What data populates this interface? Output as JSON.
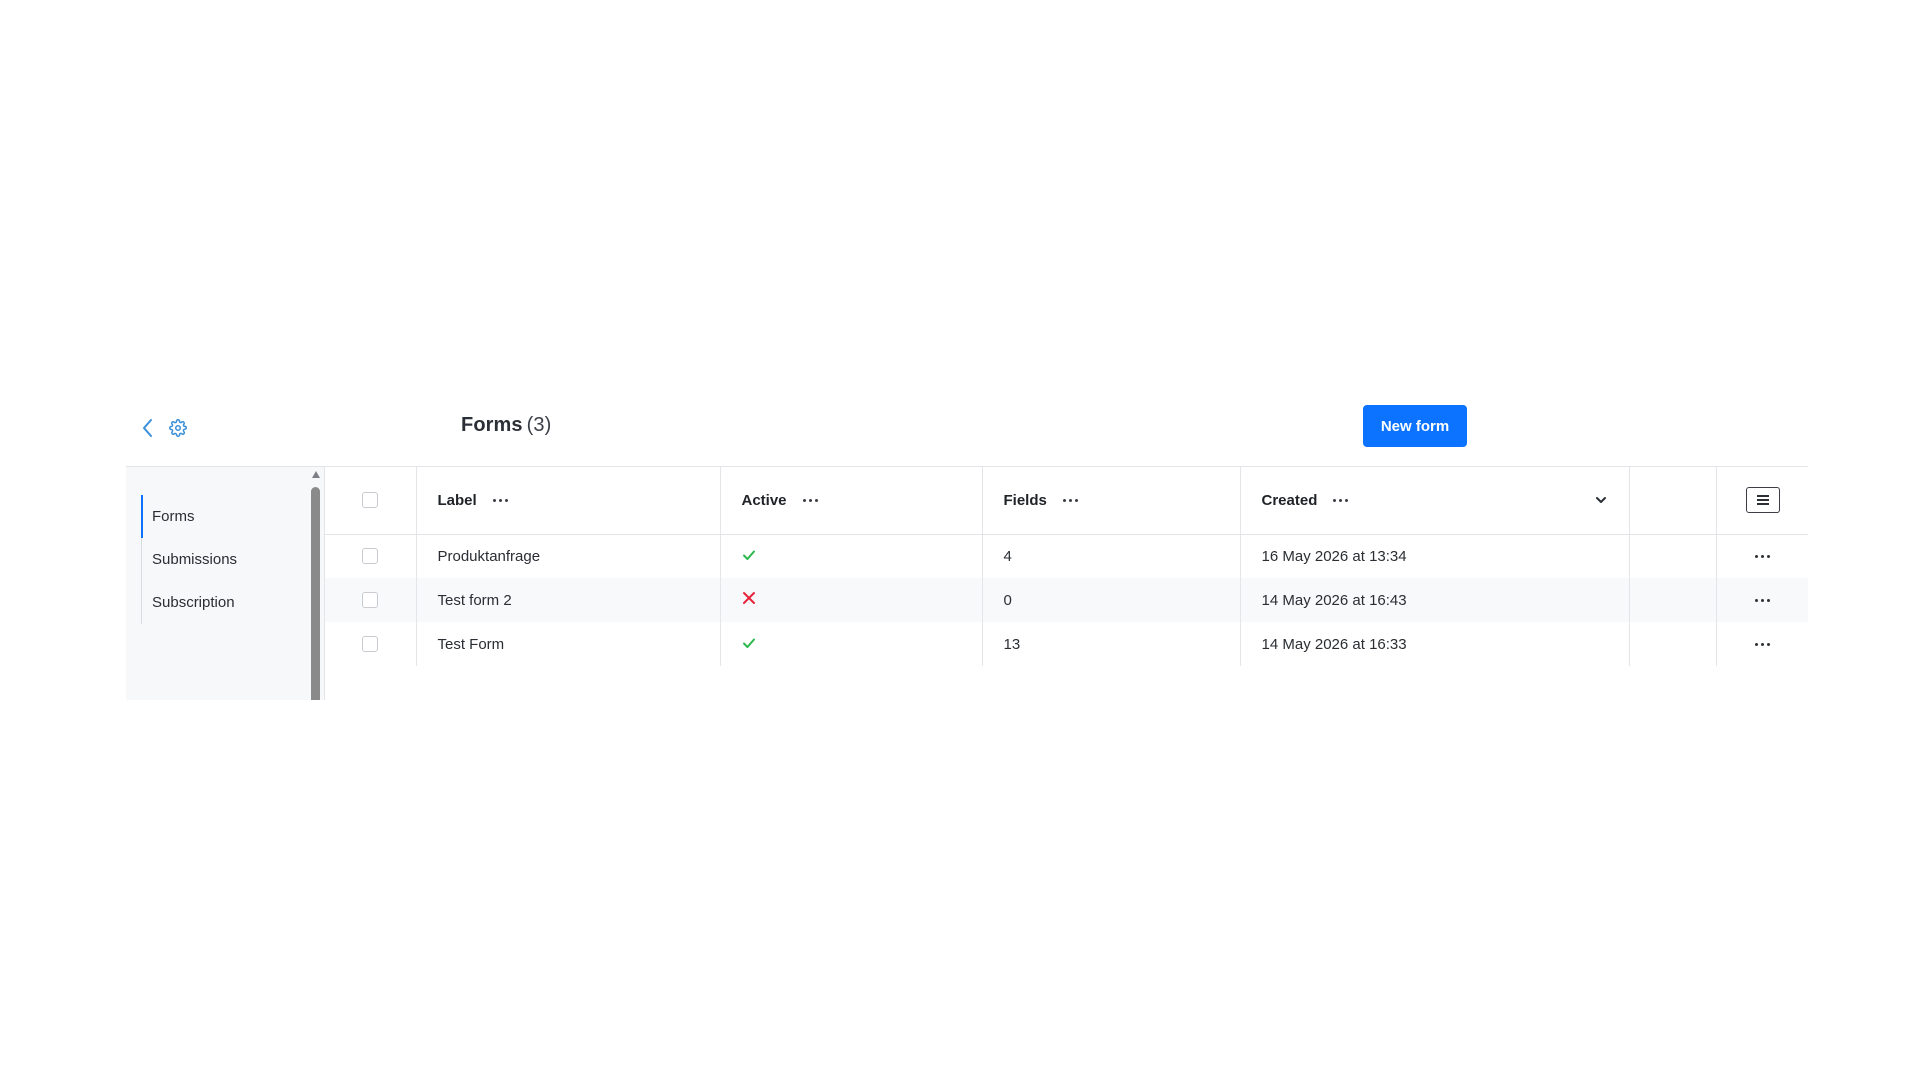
{
  "header": {
    "title": "Forms",
    "count": "(3)",
    "new_button_label": "New form"
  },
  "sidebar": {
    "items": [
      {
        "label": "Forms",
        "active": true
      },
      {
        "label": "Submissions",
        "active": false
      },
      {
        "label": "Subscription",
        "active": false
      }
    ]
  },
  "table": {
    "columns": {
      "label": "Label",
      "active": "Active",
      "fields": "Fields",
      "created": "Created"
    },
    "rows": [
      {
        "label": "Produktanfrage",
        "active": true,
        "fields": "4",
        "created": "16 May 2026 at 13:34"
      },
      {
        "label": "Test form 2",
        "active": false,
        "fields": "0",
        "created": "14 May 2026 at 16:43"
      },
      {
        "label": "Test Form",
        "active": true,
        "fields": "13",
        "created": "14 May 2026 at 16:33"
      }
    ]
  },
  "colors": {
    "accent": "#0b73ff",
    "check_green": "#2db84d",
    "cross_red": "#e5243b"
  },
  "icons": {
    "back": "chevron-left-icon",
    "settings": "gear-icon",
    "column_menu": "more-horizontal-icon",
    "sort": "chevron-down-icon",
    "layout": "list-layout-icon",
    "active_true": "check-icon",
    "active_false": "cross-icon"
  }
}
